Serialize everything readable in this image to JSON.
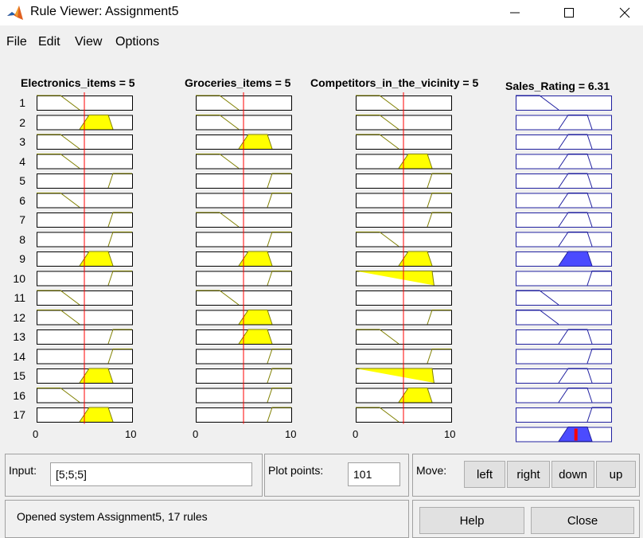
{
  "window": {
    "title": "Rule Viewer: Assignment5"
  },
  "menu": [
    "File",
    "Edit",
    "View",
    "Options"
  ],
  "inputs": [
    {
      "label": "Electronics_items = 5"
    },
    {
      "label": "Groceries_items = 5"
    },
    {
      "label": "Competitors_in_the_vicinity = 5"
    }
  ],
  "output": {
    "label": "Sales_Rating = 6.31",
    "value": 6.31
  },
  "input_values": [
    5,
    5,
    5
  ],
  "axis": {
    "min": "0",
    "max": "10"
  },
  "rules": [
    "1",
    "2",
    "3",
    "4",
    "5",
    "6",
    "7",
    "8",
    "9",
    "10",
    "11",
    "12",
    "13",
    "14",
    "15",
    "16",
    "17"
  ],
  "controls": {
    "input_label": "Input:",
    "input_value": "[5;5;5]",
    "plot_points_label": "Plot points:",
    "plot_points_value": "101",
    "move_label": "Move:",
    "left": "left",
    "right": "right",
    "down": "down",
    "up": "up",
    "help": "Help",
    "close": "Close"
  },
  "status": "Opened system Assignment5, 17 rules",
  "colors": {
    "input_fill": "#ffff00",
    "output_fill": "#4b4bff",
    "marker": "#ff0000"
  }
}
